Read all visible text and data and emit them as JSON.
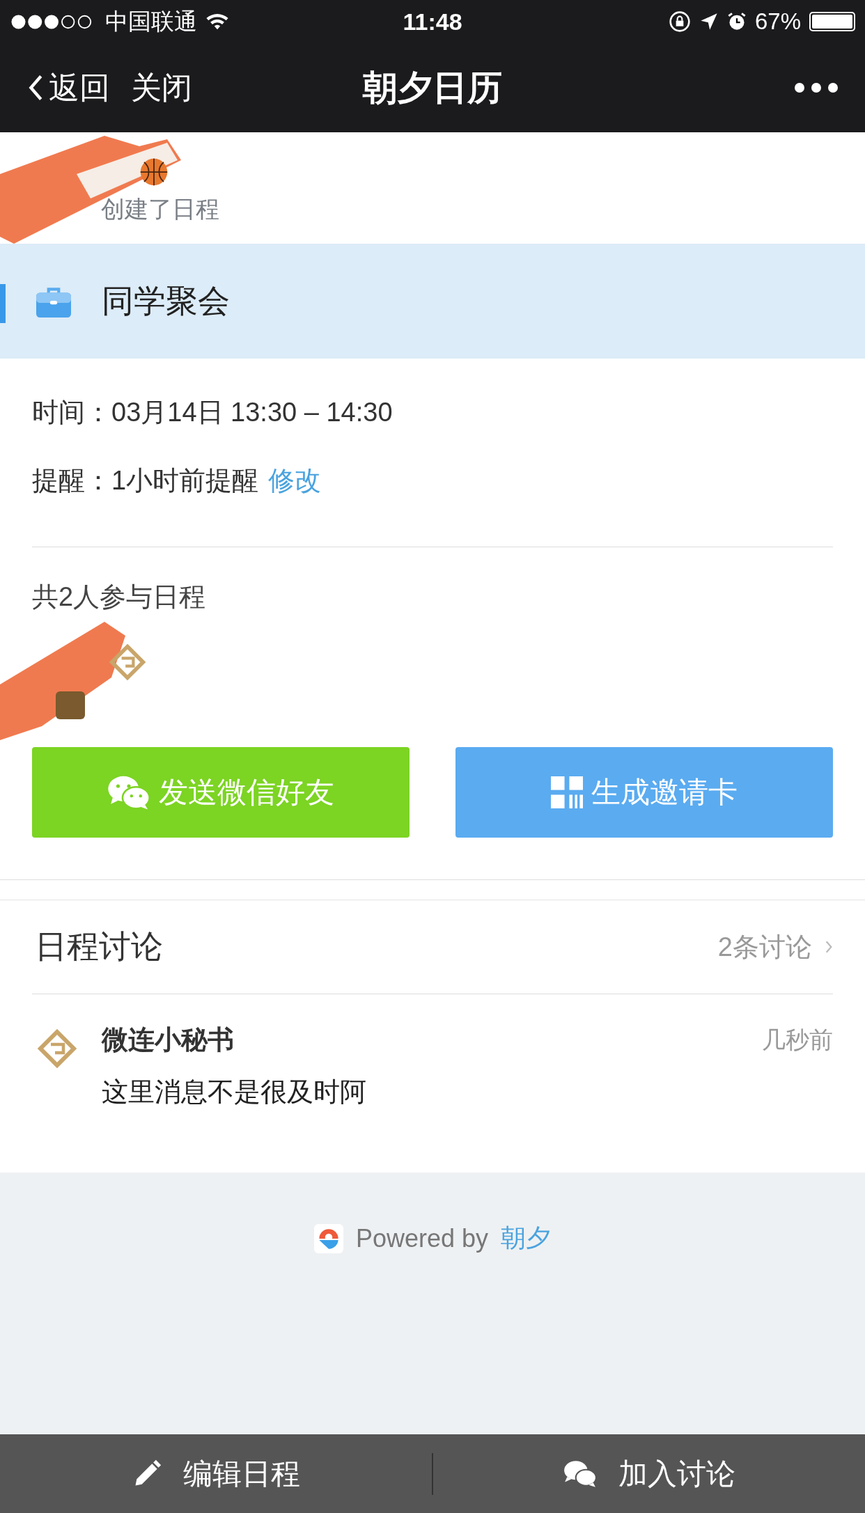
{
  "status_bar": {
    "carrier": "中国联通",
    "time": "11:48",
    "battery": "67%"
  },
  "nav": {
    "back": "返回",
    "close": "关闭",
    "title": "朝夕日历"
  },
  "creator": {
    "action": "创建了日程"
  },
  "event": {
    "title": "同学聚会"
  },
  "details": [
    {
      "label": "时间：",
      "value": "03月14日 13:30 – 14:30"
    },
    {
      "label": "提醒：",
      "value": "1小时前提醒",
      "link": "修改"
    }
  ],
  "participants": {
    "summary": "共2人参与日程"
  },
  "buttons": [
    {
      "kind": "wechat",
      "label": "发送微信好友"
    },
    {
      "kind": "invite",
      "label": "生成邀请卡"
    }
  ],
  "discussion": {
    "title": "日程讨论",
    "count": "2条讨论",
    "comments": [
      {
        "author": "微连小秘书",
        "time": "几秒前",
        "text": "这里消息不是很及时阿"
      }
    ]
  },
  "footer": {
    "powered": "Powered by",
    "brand": "朝夕"
  },
  "bottom_bar": [
    {
      "kind": "edit",
      "label": "编辑日程"
    },
    {
      "kind": "discuss",
      "label": "加入讨论"
    }
  ]
}
